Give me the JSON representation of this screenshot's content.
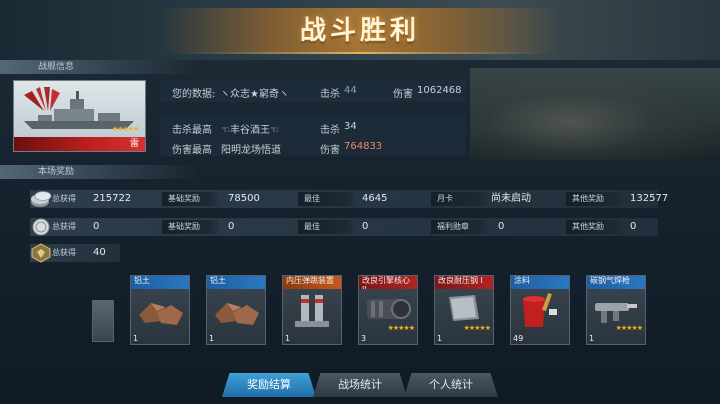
{
  "title": "战斗胜利",
  "sections": {
    "ship_info": "战舰信息",
    "rewards": "本场奖励"
  },
  "ship": {
    "name": "雷",
    "stars": "★★★★★"
  },
  "player": {
    "label": "您的数据:",
    "name": "ヽ众志★窮奇ヽ",
    "kills_label": "击杀",
    "kills": "44",
    "damage_label": "伤害",
    "damage": "1062468"
  },
  "bests": {
    "kill_best_label": "击杀最高",
    "kill_best_name": "☜丰谷酒王☜",
    "kill_best_kills_label": "击杀",
    "kill_best_kills": "34",
    "damage_best_label": "伤害最高",
    "damage_best_name": "阳明龙场悟道",
    "damage_best_damage_label": "伤害",
    "damage_best_damage": "764833"
  },
  "reward_rows": [
    {
      "icon": "silver-coins-icon",
      "total_label": "总获得",
      "total": "215722",
      "cells": [
        {
          "label": "基础奖励",
          "value": "78500"
        },
        {
          "label": "最佳",
          "value": "4645"
        },
        {
          "label": "月卡",
          "value": "尚未启动"
        },
        {
          "label": "其他奖励",
          "value": "132577"
        }
      ]
    },
    {
      "icon": "platinum-coin-icon",
      "total_label": "总获得",
      "total": "0",
      "cells": [
        {
          "label": "基础奖励",
          "value": "0"
        },
        {
          "label": "最佳",
          "value": "0"
        },
        {
          "label": "福利勋章",
          "value": "0"
        },
        {
          "label": "其他奖励",
          "value": "0"
        }
      ]
    },
    {
      "icon": "medal-badge-icon",
      "total_label": "总获得",
      "total": "40",
      "cells": []
    }
  ],
  "items": [
    {
      "name": "铝土",
      "count": "1",
      "stars": "",
      "header": "blue",
      "icon": "bauxite-ore-icon"
    },
    {
      "name": "铝土",
      "count": "1",
      "stars": "",
      "header": "blue",
      "icon": "bauxite-ore-icon"
    },
    {
      "name": "内压弹跳装置",
      "count": "1",
      "stars": "",
      "header": "orange",
      "icon": "spring-device-icon"
    },
    {
      "name": "改良引擎核心 II",
      "count": "3",
      "stars": "★★★★★",
      "header": "red",
      "icon": "engine-core-icon"
    },
    {
      "name": "改良耐压钢 I",
      "count": "1",
      "stars": "★★★★★",
      "header": "red",
      "icon": "steel-plate-icon"
    },
    {
      "name": "涂料",
      "count": "49",
      "stars": "",
      "header": "blue",
      "icon": "paint-bucket-icon"
    },
    {
      "name": "碳钢气焊枪",
      "count": "1",
      "stars": "★★★★★",
      "header": "blue",
      "icon": "welding-torch-icon"
    }
  ],
  "tabs": [
    {
      "label": "奖励结算",
      "active": true
    },
    {
      "label": "战场统计",
      "active": false
    },
    {
      "label": "个人统计",
      "active": false
    }
  ]
}
